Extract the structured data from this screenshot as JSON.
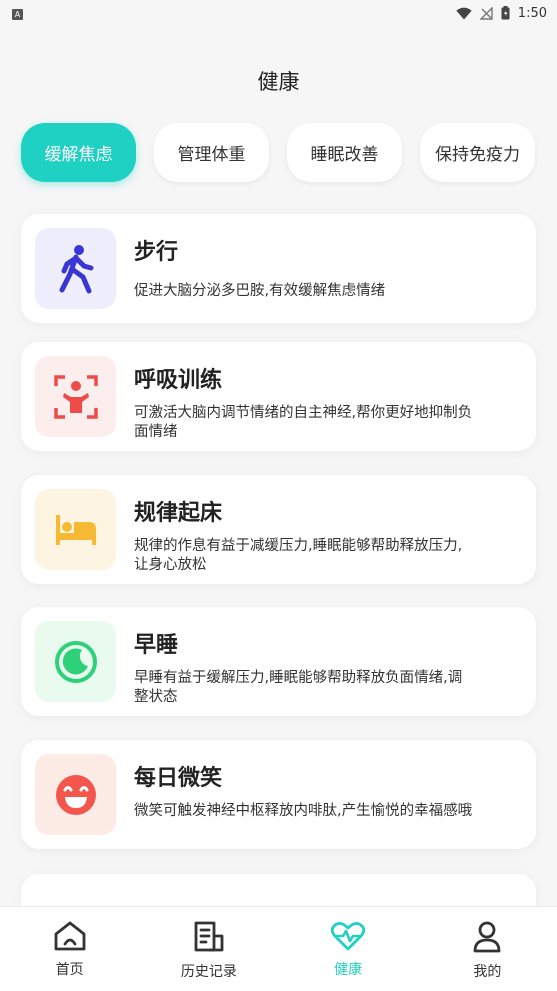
{
  "status_bar": {
    "time": "1:50",
    "left_icon": "A"
  },
  "page_title": "健康",
  "tabs": [
    {
      "label": "缓解焦虑",
      "active": true
    },
    {
      "label": "管理体重",
      "active": false
    },
    {
      "label": "睡眠改善",
      "active": false
    },
    {
      "label": "保持免疫力",
      "active": false
    }
  ],
  "cards": [
    {
      "title": "步行",
      "desc": "促进大脑分泌多巴胺,有效缓解焦虑情绪",
      "icon": "walking-person-icon",
      "bg": "#eeeefc",
      "fg": "#3a36d6"
    },
    {
      "title": "呼吸训练",
      "desc": "可激活大脑内调节情绪的自主神经,帮你更好地抑制负面情绪",
      "icon": "breathing-person-icon",
      "bg": "#fdeeee",
      "fg": "#ee4b4b"
    },
    {
      "title": "规律起床",
      "desc": "规律的作息有益于减缓压力,睡眠能够帮助释放压力,让身心放松",
      "icon": "bed-icon",
      "bg": "#fdf5e2",
      "fg": "#f6b934"
    },
    {
      "title": "早睡",
      "desc": "早睡有益于缓解压力,睡眠能够帮助释放负面情绪,调整状态",
      "icon": "moon-icon",
      "bg": "#e9faef",
      "fg": "#2fd07a"
    },
    {
      "title": "每日微笑",
      "desc": "微笑可触发神经中枢释放内啡肽,产生愉悦的幸福感哦",
      "icon": "smile-icon",
      "bg": "#fdebe6",
      "fg": "#f2564d"
    }
  ],
  "colors": {
    "accent": "#1fd1c3"
  },
  "bottom_nav": [
    {
      "label": "首页",
      "icon": "home-icon",
      "active": false
    },
    {
      "label": "历史记录",
      "icon": "history-icon",
      "active": false
    },
    {
      "label": "健康",
      "icon": "heart-pulse-icon",
      "active": true
    },
    {
      "label": "我的",
      "icon": "user-icon",
      "active": false
    }
  ]
}
